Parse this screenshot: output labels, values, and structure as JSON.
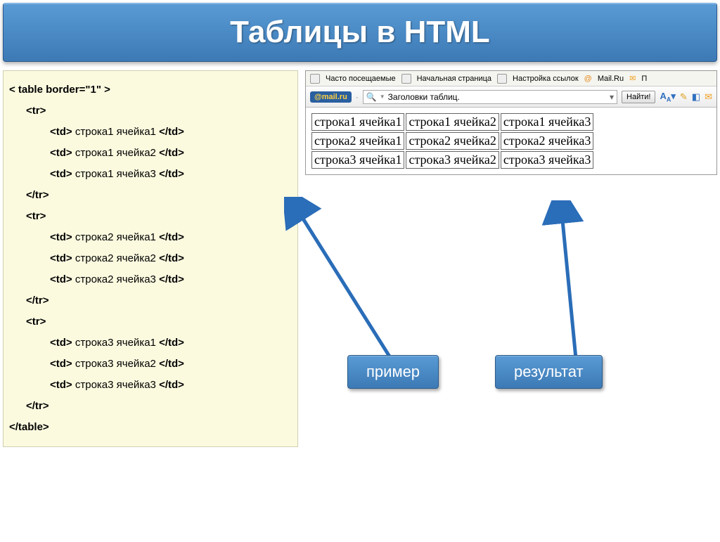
{
  "title": "Таблицы в HTML",
  "code": {
    "l0": "< table border=\"1\" >",
    "l1": "<tr>",
    "l2a": "<td>",
    "l2b": " строка1 ячейка1 ",
    "l2c": "</td>",
    "l3a": "<td>",
    "l3b": " строка1 ячейка2 ",
    "l3c": "</td>",
    "l4a": "<td>",
    "l4b": " строка1 ячейка3 ",
    "l4c": "</td>",
    "l5": "</tr>",
    "l6": "<tr>",
    "l7a": "<td>",
    "l7b": " строка2 ячейка1 ",
    "l7c": "</td>",
    "l8a": "<td>",
    "l8b": " строка2 ячейка2 ",
    "l8c": "</td>",
    "l9a": "<td>",
    "l9b": " строка2 ячейка3 ",
    "l9c": "</td>",
    "l10": "</tr>",
    "l11": "<tr>",
    "l12a": "<td>",
    "l12b": " строка3 ячейка1 ",
    "l12c": "</td>",
    "l13a": "<td>",
    "l13b": " строка3 ячейка2 ",
    "l13c": "</td>",
    "l14a": "<td>",
    "l14b": " строка3 ячейка3 ",
    "l14c": "</td>",
    "l15": "</tr>",
    "l16": "</table>"
  },
  "toolbar": {
    "frequent": "Часто посещаемые",
    "startpage": "Начальная страница",
    "linksettings": "Настройка ссылок",
    "mailru_link": "Mail.Ru",
    "partial": "П",
    "mailru_logo": "@mail.ru",
    "search_text": "Заголовки таблиц.",
    "find": "Найти!",
    "aa": "A",
    "aa_sub": "A"
  },
  "result": {
    "r1c1": "строка1 ячейка1",
    "r1c2": "строка1 ячейка2",
    "r1c3": "строка1 ячейка3",
    "r2c1": "строка2 ячейка1",
    "r2c2": "строка2 ячейка2",
    "r2c3": "строка2 ячейка3",
    "r3c1": "строка3 ячейка1",
    "r3c2": "строка3 ячейка2",
    "r3c3": "строка3 ячейка3"
  },
  "labels": {
    "example": "пример",
    "result": "результат"
  }
}
